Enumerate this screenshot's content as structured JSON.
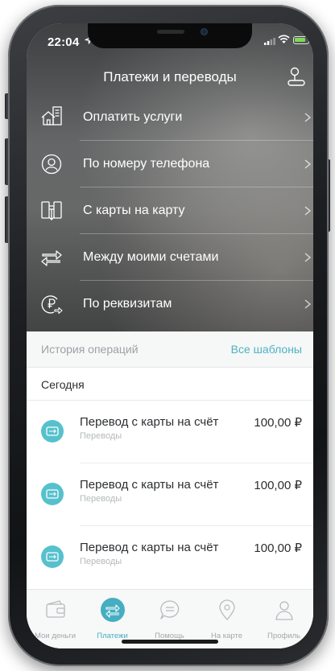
{
  "status_bar": {
    "time": "22:04"
  },
  "header": {
    "title": "Платежи и переводы"
  },
  "menu": [
    {
      "label": "Оплатить услуги",
      "icon": "house-bill-icon"
    },
    {
      "label": "По номеру телефона",
      "icon": "phone-contact-icon"
    },
    {
      "label": "С карты на карту",
      "icon": "card-transfer-icon"
    },
    {
      "label": "Между моими счетами",
      "icon": "swap-arrows-icon"
    },
    {
      "label": "По реквизитам",
      "icon": "ruble-transfer-icon"
    }
  ],
  "history": {
    "title": "История операций",
    "templates_link": "Все шаблоны",
    "day_label": "Сегодня",
    "transactions": [
      {
        "title": "Перевод с карты на счёт",
        "category": "Переводы",
        "amount": "100,00 ₽"
      },
      {
        "title": "Перевод с карты на счёт",
        "category": "Переводы",
        "amount": "100,00 ₽"
      },
      {
        "title": "Перевод с карты на счёт",
        "category": "Переводы",
        "amount": "100,00 ₽"
      }
    ]
  },
  "tabbar": [
    {
      "label": "Мои деньги",
      "icon": "wallet-icon",
      "active": false
    },
    {
      "label": "Платежи",
      "icon": "payments-arrow-icon",
      "active": true
    },
    {
      "label": "Помощь",
      "icon": "chat-bubble-icon",
      "active": false
    },
    {
      "label": "На карте",
      "icon": "map-pin-icon",
      "active": false
    },
    {
      "label": "Профиль",
      "icon": "profile-icon",
      "active": false
    }
  ],
  "colors": {
    "accent": "#4bb3c4",
    "transaction_icon": "#56c1cd",
    "battery": "#7ed957"
  }
}
